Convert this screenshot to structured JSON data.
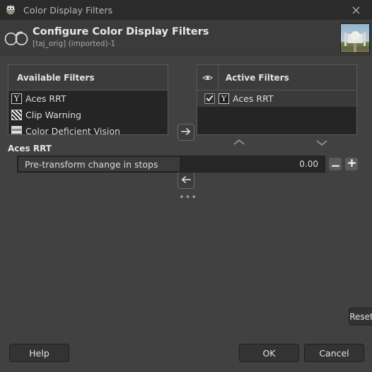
{
  "titlebar": {
    "icon": "gimp-wilber-icon",
    "title": "Color Display Filters",
    "close_icon": "close-icon"
  },
  "header": {
    "icon": "glasses-icon",
    "title": "Configure Color Display Filters",
    "subtitle": "[taj_orig] (imported)-1",
    "thumbnail_icon": "image-thumbnail"
  },
  "available": {
    "header": "Available Filters",
    "items": [
      {
        "label": "Aces RRT",
        "icon": "gamma-icon",
        "glyph": "Y"
      },
      {
        "label": "Clip Warning",
        "icon": "stripes-icon"
      },
      {
        "label": "Color Deficient Vision",
        "icon": "bands-icon"
      },
      {
        "label": "",
        "icon": "bands-icon"
      }
    ]
  },
  "active": {
    "eye_icon": "eye-icon",
    "header": "Active Filters",
    "items": [
      {
        "label": "Aces RRT",
        "icon": "gamma-icon",
        "glyph": "Y",
        "checked": true,
        "selected": true
      }
    ]
  },
  "transfer": {
    "add_icon": "arrow-right-icon",
    "remove_icon": "arrow-left-icon",
    "more_label": "•••"
  },
  "reorder": {
    "up_icon": "chevron-up-icon",
    "down_icon": "chevron-down-icon"
  },
  "settings": {
    "title": "Aces RRT",
    "slider_label": "Pre-transform change in stops",
    "slider_value": "0.00",
    "decrement_icon": "minus-icon",
    "increment_icon": "plus-icon"
  },
  "reset": {
    "label": "Reset"
  },
  "footer": {
    "help_label": "Help",
    "ok_label": "OK",
    "cancel_label": "Cancel"
  },
  "colors": {
    "window_bg": "#414141",
    "titlebar_bg": "#2b2b2b",
    "header_bg": "#3b3b3b",
    "list_bg": "#252525",
    "list_header_bg": "#3c3c3c",
    "selection_bg": "#3a3a3a",
    "text": "#dcdcdc"
  }
}
